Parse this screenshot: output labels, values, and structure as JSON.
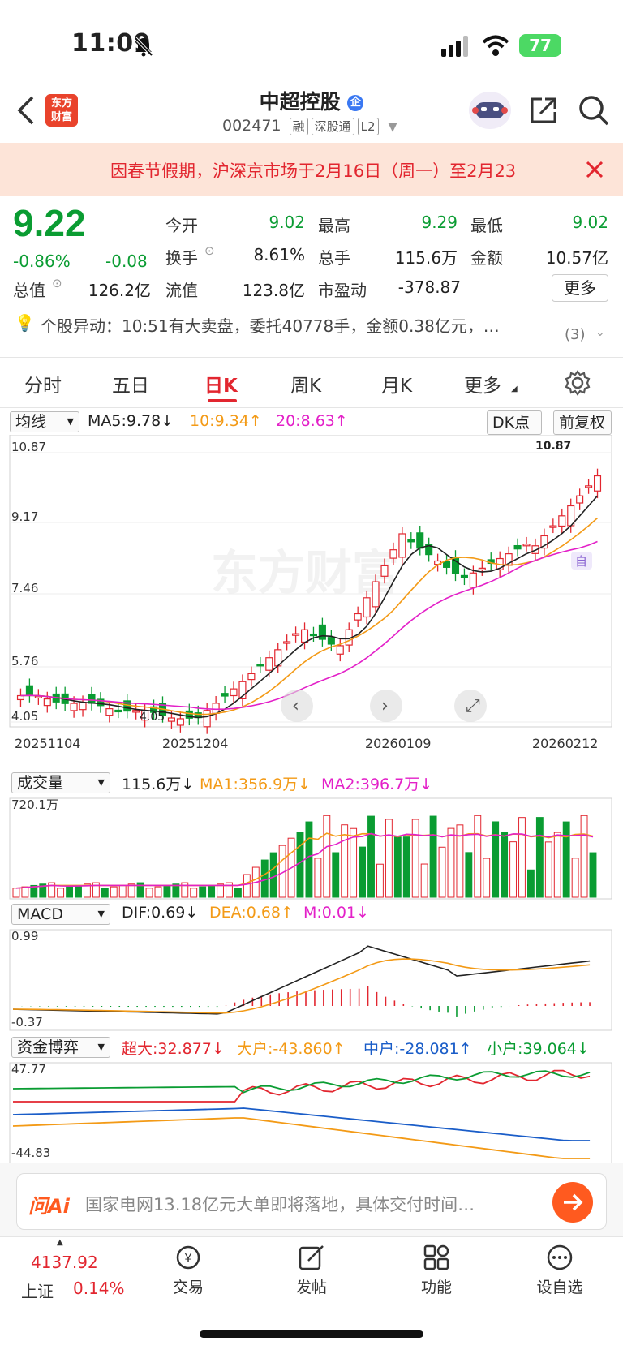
{
  "status_bar": {
    "time": "11:09",
    "battery": "77"
  },
  "header": {
    "logo_text": "东方财富",
    "title": "中超控股",
    "title_badge": "企",
    "code": "002471",
    "tags": [
      "融",
      "深股通",
      "L2"
    ]
  },
  "banner": {
    "text": "因春节假期，沪深京市场于2月16日（周一）至2月23"
  },
  "quote": {
    "price": "9.22",
    "change_pct": "-0.86%",
    "change": "-0.08",
    "fields": [
      {
        "label": "今开",
        "value": "9.02",
        "color": "green"
      },
      {
        "label": "最高",
        "value": "9.29",
        "color": "green"
      },
      {
        "label": "最低",
        "value": "9.02",
        "color": "green"
      },
      {
        "label": "换手",
        "value": "8.61%",
        "color": "normal"
      },
      {
        "label": "总手",
        "value": "115.6万",
        "color": "normal"
      },
      {
        "label": "金额",
        "value": "10.57亿",
        "color": "normal"
      },
      {
        "label": "总值",
        "value": "126.2亿",
        "color": "normal"
      },
      {
        "label": "流值",
        "value": "123.8亿",
        "color": "normal"
      },
      {
        "label": "市盈动",
        "value": "-378.87",
        "color": "normal"
      }
    ],
    "more_label": "更多"
  },
  "alert": {
    "text": "个股异动：10:51有大卖盘，委托40778手，金额0.38亿元，…",
    "count": "(3)"
  },
  "tabs": [
    "分时",
    "五日",
    "日K",
    "周K",
    "月K",
    "更多"
  ],
  "active_tab": "日K",
  "kline": {
    "selector": "均线",
    "ma5": "MA5:9.78↓",
    "ma10": "10:9.34↑",
    "ma20": "20:8.63↑",
    "dk_label": "DK点",
    "fq_label": "前复权",
    "y_labels": [
      "10.87",
      "9.17",
      "7.46",
      "5.76",
      "4.05"
    ],
    "x_labels": [
      "20251104",
      "20251204",
      "20260109",
      "20260212"
    ],
    "high_label": "10.87",
    "low_label": "4.05",
    "self_label": "自",
    "watermark": "东方财富"
  },
  "volume": {
    "selector": "成交量",
    "value": "115.6万↓",
    "ma1": "MA1:356.9万↓",
    "ma2": "MA2:396.7万↓",
    "max_label": "720.1万"
  },
  "macd": {
    "selector": "MACD",
    "dif": "DIF:0.69↓",
    "dea": "DEA:0.68↑",
    "m": "M:0.01↓",
    "max_label": "0.99",
    "min_label": "-0.37"
  },
  "fund": {
    "selector": "资金博弈",
    "super": "超大:32.877↓",
    "large": "大户:-43.860↑",
    "mid": "中户:-28.081↑",
    "small": "小户:39.064↓",
    "max_label": "47.77",
    "min_label": "-44.83"
  },
  "ask_ai": {
    "brand": "问Ai",
    "text": "国家电网13.18亿元大单即将落地，具体交付时间…"
  },
  "bottom_bar": {
    "index_value": "4137.92",
    "index_name": "上证",
    "index_change": "0.14%",
    "items": [
      "交易",
      "发帖",
      "功能",
      "设自选"
    ]
  },
  "colors": {
    "up": "#e2262f",
    "down": "#0a9c32",
    "ma10": "#f39a16",
    "ma20": "#e320c8",
    "accent": "#ff5a1f"
  }
}
